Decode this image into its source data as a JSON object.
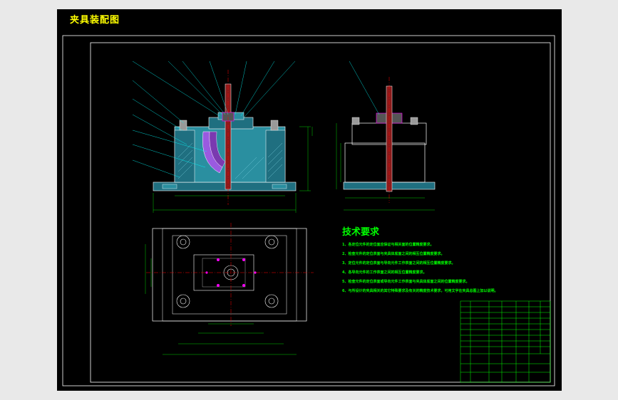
{
  "drawing": {
    "title": "夹具装配图",
    "tech_requirements_title": "技术要求",
    "tech_requirements": [
      "1、各定位元件的定位面应保证与相关面的位置精度要求。",
      "2、检查元件的定位表面与夹具体底面之间的相互位置精度要求。",
      "3、定位元件的定位表面与导向元件工作表面之间的相互位置精度要求。",
      "4、各导向元件的工作表面之间的相互位置精度要求。",
      "5、检查元件的定位表面或导向元件工作表面与夹具体底面之间的位置精度要求。",
      "6、与所设计的夹具相关的其它特殊要求及有关的精度技术要求，可用文字在夹具总图上加以说明。"
    ]
  },
  "colors": {
    "background": "#000000",
    "outline": "#ffffff",
    "dimension": "#00ff00",
    "leader": "#00ffff",
    "centerline": "#ff0000",
    "body_fill": "#2a8fa0",
    "hatch": "#9a5ae0",
    "highlight": "#ff00ff",
    "title": "#ffff00"
  }
}
